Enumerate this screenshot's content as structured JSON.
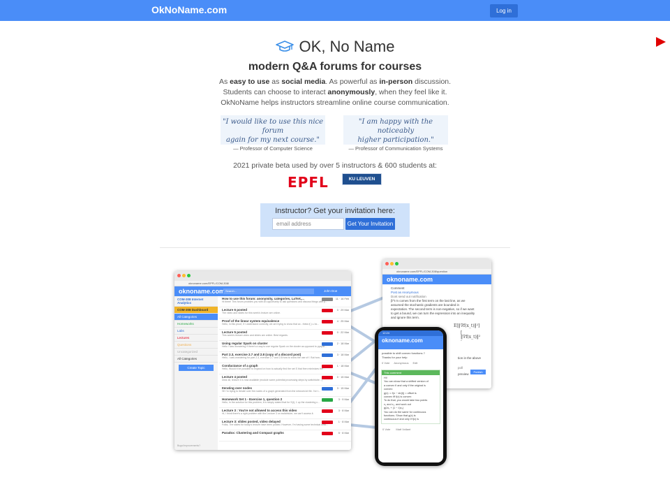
{
  "nav": {
    "brand": "OkNoName.com",
    "login": "Log in"
  },
  "hero": {
    "title": "OK, No Name",
    "subtitle": "modern Q&A forums for courses",
    "line1": {
      "p1": "As ",
      "b1": "easy to use",
      "p2": " as ",
      "b2": "social media",
      "p3": ". As powerful as ",
      "b3": "in-person",
      "p4": " discussion."
    },
    "line2": {
      "p1": "Students can choose to interact ",
      "b1": "anonymously",
      "p2": ", when they feel like it."
    },
    "line3": "OkNoName helps instructors streamline online course communication."
  },
  "quotes": [
    {
      "text1": "\"I would like to use this nice forum",
      "text2": "again for my next course.\"",
      "author": "— Professor of Computer Science"
    },
    {
      "text1": "\"I am happy with the noticeably",
      "text2": "higher participation.\"",
      "author": "— Professor of Communication Systems"
    }
  ],
  "beta": {
    "text": "2021 private beta used by over 5 instructors & 600 students at:",
    "epfl": "EPFL",
    "kul": "KU LEUVEN"
  },
  "invite": {
    "title": "Instructor? Get your invitation here:",
    "placeholder": "email address",
    "button": "Get Your Invitation"
  },
  "screens": {
    "desktop": {
      "url": "oknoname.com/EPFL/COM-308/",
      "app": "oknoname.com",
      "search": "Search...",
      "user": "John Doe",
      "sidebar": [
        "COM-308 Internet Analytics",
        "COM-308 Dashboard",
        "All Categories",
        "Homeworks",
        "Labs",
        "Lectures",
        "Questions",
        "Uncategorized",
        "All Categories",
        "Create Topic"
      ],
      "footer": "Bugs/Improvements?",
      "rows": [
        {
          "title": "How to use this forum: anonymity, categories, LaTeX,...",
          "sub": "Hi there! This forum provides you with an opportunity to ask questions and discuss things with y...",
          "meta": "11 · 16 Feb"
        },
        {
          "title": "Lecture 6 posted",
          "sub": "The video and slides for this week's lecture are online.",
          "meta": "0 · 29 Mar"
        },
        {
          "title": "Proof of the linear system equivalence",
          "sub": "Hello, in this proof, if I understand correctly, we are trying to show that ax - theta f(.) ≤ bx...",
          "meta": "4 · 25 Mar"
        },
        {
          "title": "Lecture 5 posted",
          "sub": "This week's lecture video and slides are online. Best regards.",
          "meta": "0 · 22 Mar"
        },
        {
          "title": "Using regular Spark on cluster",
          "sub": "Hello I was wondering if there's a way to use regular Spark on the cluster as opposed to pyspar...",
          "meta": "2 · 18 Mar"
        },
        {
          "title": "Part 2.3, exercise 2.7 and 2.8 (copy of a discord post)",
          "sub": "Hello, I was wondering for part 2.3, exercise 2.7 and 2.8 how to show the use of f. But how...",
          "meta": "3 · 18 Mar"
        },
        {
          "title": "Conductance of a graph",
          "sub": "Hello, Would it be possible to expand on how to actually find the set S that then minimizes the...",
          "meta": "1 · 18 Mar"
        },
        {
          "title": "Lecture 4 posted",
          "sub": "Dear all, lecture 4 is now available (module some potential processing steps by switchtube...)",
          "meta": "0 · 15 Mar"
        },
        {
          "title": "Iterating over nodes",
          "sub": "Hi! I'm trying to iterate over the nodes of a graph generated from the network.txt file. I've t...",
          "meta": "3 · 15 Mar"
        },
        {
          "title": "Homework Set 1 - Exercise 1, question 2",
          "sub": "Hello, In the solution for this problem, it is simply stated that for S(t), 1 up the clustering c...",
          "meta": "3 · 9 Mar"
        },
        {
          "title": "Lecture 3 : You're not allowed to access this video",
          "sub": "Hi, I think there's a right problem with the Lecture 3 on switchtube, we can't access it.",
          "meta": "3 · 8 Mar"
        },
        {
          "title": "Lecture 3: slides posted, video delayed",
          "sub": "Folks, The slides for today's lecture have been posted. However, I'm having some technical diffic...",
          "meta": "1 · 8 Mar"
        },
        {
          "title": "Paradox: Clustering and Compact graphs",
          "sub": "",
          "meta": "5 · 8 Mar"
        }
      ]
    },
    "browser2": {
      "url": "oknoname.com/EPFL/COM-308/question",
      "app": "oknoname.com",
      "lines": [
        "Comment",
        "Post as Anonymous",
        "Dont send out notification",
        "β^t m comes from the first term on the last line, as we",
        "assumed the stochastic gradients are bounded in",
        "expectation. The second term is non-negative, so if we want",
        "to get a bound, we can turn the expression into an inequality",
        "and ignore this term."
      ],
      "math": [
        "E[‖∇f(x_t)‖²]",
        "[ ‖∇f(x_t)‖² ·"
      ],
      "bottom": [
        "tion in the above",
        "poll",
        "preview",
        "Publish"
      ]
    },
    "phone": {
      "time": "12:24",
      "app": "oknoname.com",
      "lines": [
        "possible to shift convex functions ?",
        "Thanks for your help",
        "0 Vote",
        "Anonymous",
        "Edit"
      ],
      "comment_header": "This comment",
      "comment": [
        "Hi!",
        "You can show that a shifted version of",
        "a convex fi and only if the original is",
        "convex:",
        "g(x) := f(x − sh(t)) = offset is",
        "convex iff f(x) is convex",
        "To do that, you would take two points",
        "x₁ and x₂, and work out",
        "g(λx₁ + (1 − λ)x₂)",
        "You can do the same for continuous",
        "functions. Show that g(x) is",
        "continuous if and only if f(x) is"
      ],
      "footer": [
        "0 Vote",
        "Matt Vollant"
      ]
    }
  },
  "colors": {
    "nav": "#4a8df8",
    "button": "#2f6fd8",
    "invite_bg": "#cfe2fa",
    "quote_bg": "#eef4fb",
    "epfl": "#e2001a",
    "kul": "#1f4f8f"
  }
}
